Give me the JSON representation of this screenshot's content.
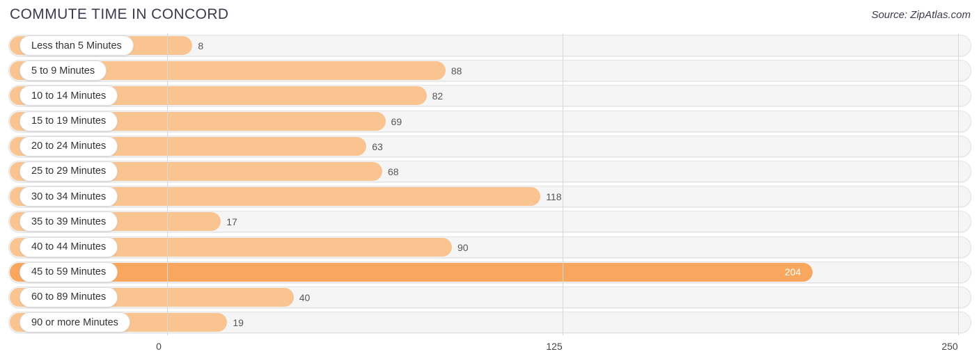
{
  "header": {
    "title": "COMMUTE TIME IN CONCORD",
    "source": "Source: ZipAtlas.com"
  },
  "colors": {
    "bar": "#fac490",
    "bar_highlight": "#f9a65e",
    "track": "#f5f5f5",
    "gridline": "#d8d8d8",
    "title_text": "#3b3b4f"
  },
  "chart_data": {
    "type": "bar",
    "orientation": "horizontal",
    "title": "COMMUTE TIME IN CONCORD",
    "xlabel": "",
    "ylabel": "",
    "xlim": [
      0,
      250
    ],
    "xticks": [
      "0",
      "125",
      "250"
    ],
    "xtick_values": [
      0,
      125,
      250
    ],
    "grid": true,
    "legend": false,
    "categories": [
      "Less than 5 Minutes",
      "5 to 9 Minutes",
      "10 to 14 Minutes",
      "15 to 19 Minutes",
      "20 to 24 Minutes",
      "25 to 29 Minutes",
      "30 to 34 Minutes",
      "35 to 39 Minutes",
      "40 to 44 Minutes",
      "45 to 59 Minutes",
      "60 to 89 Minutes",
      "90 or more Minutes"
    ],
    "values": [
      8,
      88,
      82,
      69,
      63,
      68,
      118,
      17,
      90,
      204,
      40,
      19
    ],
    "value_labels": [
      "8",
      "88",
      "82",
      "69",
      "63",
      "68",
      "118",
      "17",
      "90",
      "204",
      "40",
      "19"
    ],
    "highlighted_index": 9
  }
}
